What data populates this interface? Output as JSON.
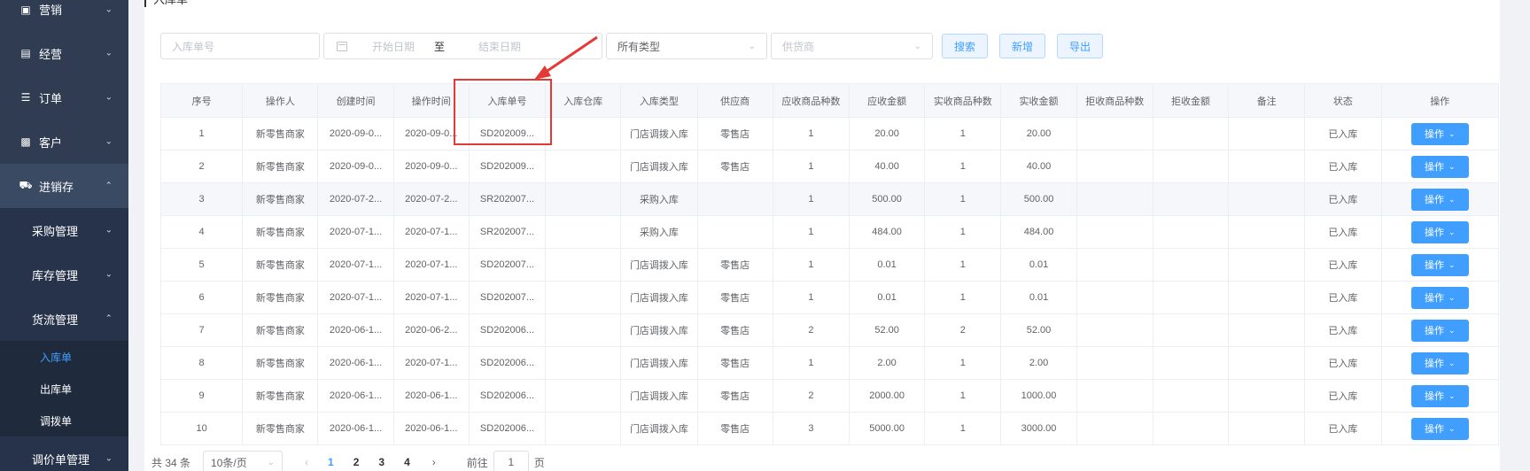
{
  "sidebar": {
    "items": [
      {
        "label": "营销",
        "icon": "gift-icon"
      },
      {
        "label": "经营",
        "icon": "bar-chart-icon"
      },
      {
        "label": "订单",
        "icon": "list-icon"
      },
      {
        "label": "客户",
        "icon": "id-card-icon"
      },
      {
        "label": "进销存",
        "icon": "truck-icon"
      }
    ],
    "sub_items": [
      "采购管理",
      "库存管理",
      "货流管理"
    ],
    "leaves": [
      "入库单",
      "出库单",
      "调拨单"
    ],
    "bottom_item": "调价单管理"
  },
  "page": {
    "title": "入库单"
  },
  "filters": {
    "order_no_placeholder": "入库单号",
    "start_date_placeholder": "开始日期",
    "range_separator": "至",
    "end_date_placeholder": "结束日期",
    "type_value": "所有类型",
    "supplier_placeholder": "供货商",
    "search_label": "搜索",
    "add_label": "新增",
    "export_label": "导出"
  },
  "table": {
    "headers": [
      "序号",
      "操作人",
      "创建时间",
      "操作时间",
      "入库单号",
      "入库仓库",
      "入库类型",
      "供应商",
      "应收商品种数",
      "应收金额",
      "实收商品种数",
      "实收金额",
      "拒收商品种数",
      "拒收金额",
      "备注",
      "状态",
      "操作"
    ],
    "op_label": "操作",
    "rows": [
      {
        "no": "1",
        "operator": "新零售商家",
        "created": "2020-09-0...",
        "operated": "2020-09-0...",
        "order_no": "SD202009...",
        "warehouse": "",
        "type": "门店调拨入库",
        "supplier": "零售店",
        "recv_kinds": "1",
        "recv_amount": "20.00",
        "actual_kinds": "1",
        "actual_amount": "20.00",
        "reject_kinds": "",
        "reject_amount": "",
        "remark": "",
        "status": "已入库"
      },
      {
        "no": "2",
        "operator": "新零售商家",
        "created": "2020-09-0...",
        "operated": "2020-09-0...",
        "order_no": "SD202009...",
        "warehouse": "",
        "type": "门店调拨入库",
        "supplier": "零售店",
        "recv_kinds": "1",
        "recv_amount": "40.00",
        "actual_kinds": "1",
        "actual_amount": "40.00",
        "reject_kinds": "",
        "reject_amount": "",
        "remark": "",
        "status": "已入库"
      },
      {
        "no": "3",
        "operator": "新零售商家",
        "created": "2020-07-2...",
        "operated": "2020-07-2...",
        "order_no": "SR202007...",
        "warehouse": "",
        "type": "采购入库",
        "supplier": "",
        "recv_kinds": "1",
        "recv_amount": "500.00",
        "actual_kinds": "1",
        "actual_amount": "500.00",
        "reject_kinds": "",
        "reject_amount": "",
        "remark": "",
        "status": "已入库"
      },
      {
        "no": "4",
        "operator": "新零售商家",
        "created": "2020-07-1...",
        "operated": "2020-07-1...",
        "order_no": "SR202007...",
        "warehouse": "",
        "type": "采购入库",
        "supplier": "",
        "recv_kinds": "1",
        "recv_amount": "484.00",
        "actual_kinds": "1",
        "actual_amount": "484.00",
        "reject_kinds": "",
        "reject_amount": "",
        "remark": "",
        "status": "已入库"
      },
      {
        "no": "5",
        "operator": "新零售商家",
        "created": "2020-07-1...",
        "operated": "2020-07-1...",
        "order_no": "SD202007...",
        "warehouse": "",
        "type": "门店调拨入库",
        "supplier": "零售店",
        "recv_kinds": "1",
        "recv_amount": "0.01",
        "actual_kinds": "1",
        "actual_amount": "0.01",
        "reject_kinds": "",
        "reject_amount": "",
        "remark": "",
        "status": "已入库"
      },
      {
        "no": "6",
        "operator": "新零售商家",
        "created": "2020-07-1...",
        "operated": "2020-07-1...",
        "order_no": "SD202007...",
        "warehouse": "",
        "type": "门店调拨入库",
        "supplier": "零售店",
        "recv_kinds": "1",
        "recv_amount": "0.01",
        "actual_kinds": "1",
        "actual_amount": "0.01",
        "reject_kinds": "",
        "reject_amount": "",
        "remark": "",
        "status": "已入库"
      },
      {
        "no": "7",
        "operator": "新零售商家",
        "created": "2020-06-1...",
        "operated": "2020-06-2...",
        "order_no": "SD202006...",
        "warehouse": "",
        "type": "门店调拨入库",
        "supplier": "零售店",
        "recv_kinds": "2",
        "recv_amount": "52.00",
        "actual_kinds": "2",
        "actual_amount": "52.00",
        "reject_kinds": "",
        "reject_amount": "",
        "remark": "",
        "status": "已入库"
      },
      {
        "no": "8",
        "operator": "新零售商家",
        "created": "2020-06-1...",
        "operated": "2020-07-1...",
        "order_no": "SD202006...",
        "warehouse": "",
        "type": "门店调拨入库",
        "supplier": "零售店",
        "recv_kinds": "1",
        "recv_amount": "2.00",
        "actual_kinds": "1",
        "actual_amount": "2.00",
        "reject_kinds": "",
        "reject_amount": "",
        "remark": "",
        "status": "已入库"
      },
      {
        "no": "9",
        "operator": "新零售商家",
        "created": "2020-06-1...",
        "operated": "2020-06-1...",
        "order_no": "SD202006...",
        "warehouse": "",
        "type": "门店调拨入库",
        "supplier": "零售店",
        "recv_kinds": "2",
        "recv_amount": "2000.00",
        "actual_kinds": "1",
        "actual_amount": "1000.00",
        "reject_kinds": "",
        "reject_amount": "",
        "remark": "",
        "status": "已入库"
      },
      {
        "no": "10",
        "operator": "新零售商家",
        "created": "2020-06-1...",
        "operated": "2020-06-1...",
        "order_no": "SD202006...",
        "warehouse": "",
        "type": "门店调拨入库",
        "supplier": "零售店",
        "recv_kinds": "3",
        "recv_amount": "5000.00",
        "actual_kinds": "1",
        "actual_amount": "3000.00",
        "reject_kinds": "",
        "reject_amount": "",
        "remark": "",
        "status": "已入库"
      }
    ]
  },
  "pagination": {
    "total_text": "共 34 条",
    "page_size": "10条/页",
    "prev": "‹",
    "pages": [
      "1",
      "2",
      "3",
      "4"
    ],
    "current": "1",
    "next": "›",
    "goto_label": "前往",
    "goto_value": "1",
    "page_suffix": "页"
  },
  "annotation": {
    "color": "#e53935"
  }
}
